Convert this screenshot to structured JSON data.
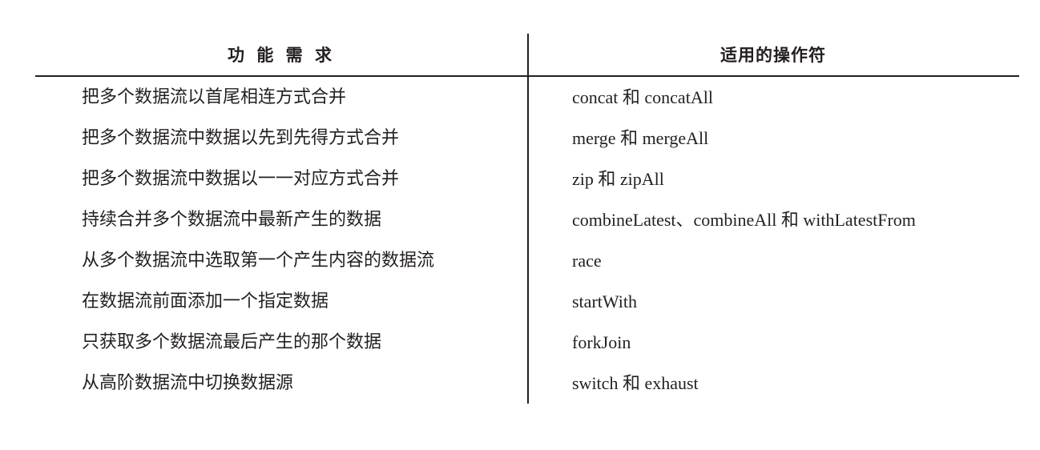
{
  "table": {
    "headers": {
      "requirement": "功 能 需 求",
      "operators": "适用的操作符"
    },
    "rows": [
      {
        "requirement": "把多个数据流以首尾相连方式合并",
        "operators": "concat 和 concatAll"
      },
      {
        "requirement": "把多个数据流中数据以先到先得方式合并",
        "operators": "merge 和 mergeAll"
      },
      {
        "requirement": "把多个数据流中数据以一一对应方式合并",
        "operators": "zip 和 zipAll"
      },
      {
        "requirement": "持续合并多个数据流中最新产生的数据",
        "operators": "combineLatest、combineAll 和 withLatestFrom"
      },
      {
        "requirement": "从多个数据流中选取第一个产生内容的数据流",
        "operators": "race"
      },
      {
        "requirement": "在数据流前面添加一个指定数据",
        "operators": "startWith"
      },
      {
        "requirement": "只获取多个数据流最后产生的那个数据",
        "operators": "forkJoin"
      },
      {
        "requirement": "从高阶数据流中切换数据源",
        "operators": "switch 和 exhaust"
      }
    ]
  }
}
